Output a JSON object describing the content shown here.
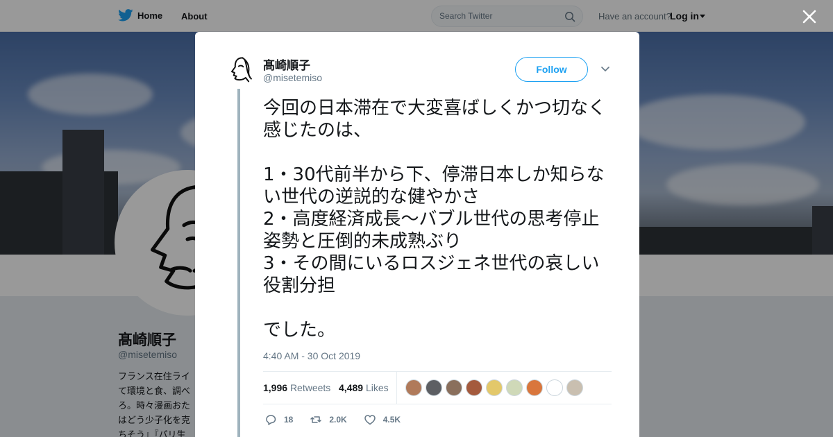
{
  "nav": {
    "home_label": "Home",
    "about_label": "About",
    "search_placeholder": "Search Twitter",
    "have_account": "Have an account?",
    "login_label": "Log in",
    "brand_color": "#1da1f2"
  },
  "profile": {
    "name": "髙崎順子",
    "handle": "@misetemiso",
    "bio_visible": "フランス在住ライ\nて環境と食、調べ\nろ。時々漫画おた\nはどう少子化を克\nちそう』『パリ生"
  },
  "tweet": {
    "author_name": "髙崎順子",
    "author_handle": "@misetemiso",
    "follow_label": "Follow",
    "text": "今回の日本滞在で大変喜ばしくかつ切なく感じたのは、\n\n1・30代前半から下、停滞日本しか知らない世代の逆説的な健やかさ\n2・高度経済成長〜バブル世代の思考停止姿勢と圧倒的未成熟ぶり\n3・その間にいるロスジェネ世代の哀しい役割分担\n\nでした。",
    "timestamp": "4:40 AM - 30 Oct 2019",
    "retweets_count": "1,996",
    "retweets_label": "Retweets",
    "likes_count": "4,489",
    "likes_label": "Likes",
    "liker_colors": [
      "#b07a5a",
      "#5d5f63",
      "#8a6f5c",
      "#a45a3d",
      "#e3c86a",
      "#cfd9b8",
      "#d9763c",
      "#ffffff",
      "#c9bfb0"
    ],
    "actions": {
      "reply": "18",
      "retweet": "2.0K",
      "like": "4.5K"
    }
  }
}
